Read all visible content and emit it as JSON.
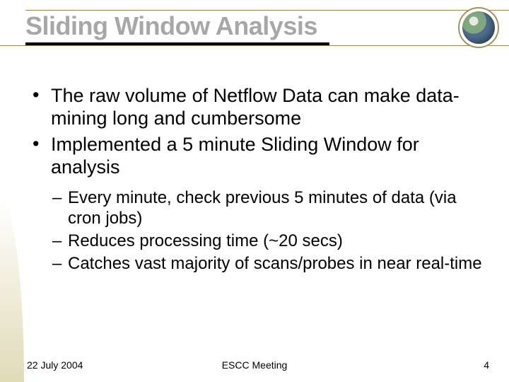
{
  "title": "Sliding Window Analysis",
  "bullets": {
    "level1": [
      "The raw volume of Netflow Data can make data-mining long and cumbersome",
      "Implemented a 5 minute Sliding Window for analysis"
    ],
    "level2": [
      "Every minute, check previous 5 minutes of data (via cron jobs)",
      "Reduces processing time (~20 secs)",
      "Catches vast majority of scans/probes in near real-time"
    ]
  },
  "footer": {
    "date": "22 July 2004",
    "center": "ESCC Meeting",
    "page": "4"
  }
}
